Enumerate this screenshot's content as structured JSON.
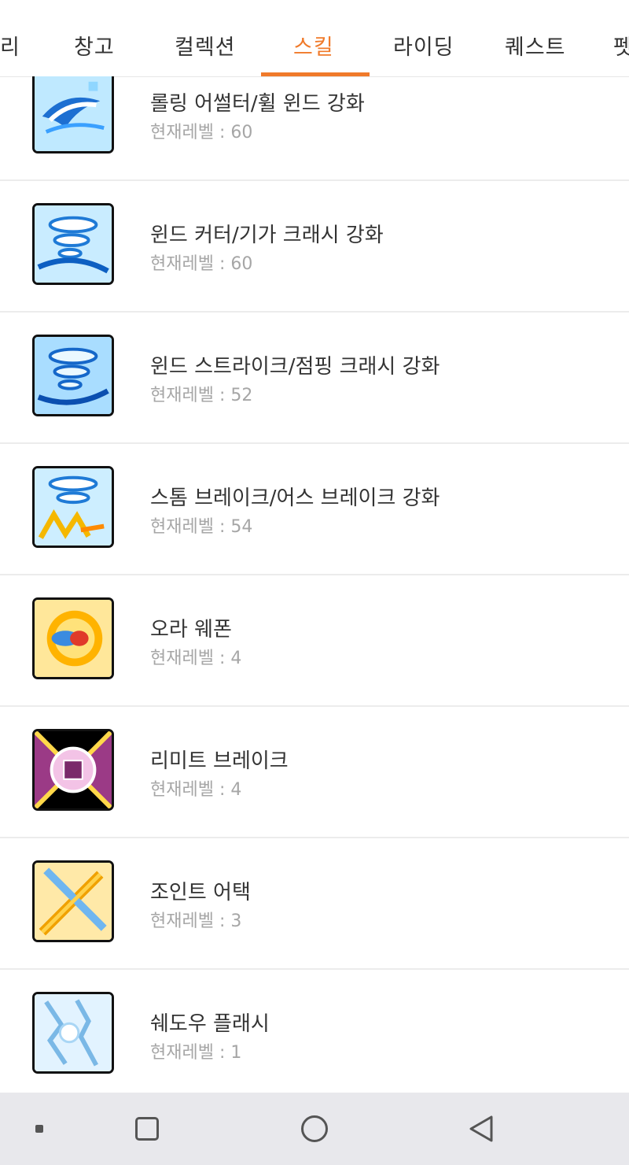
{
  "tabs": [
    {
      "label": "리",
      "active": false
    },
    {
      "label": "창고",
      "active": false
    },
    {
      "label": "컬렉션",
      "active": false
    },
    {
      "label": "스킬",
      "active": true
    },
    {
      "label": "라이딩",
      "active": false
    },
    {
      "label": "퀘스트",
      "active": false
    },
    {
      "label": "펫",
      "active": false
    }
  ],
  "colors": {
    "accent": "#f07a2a",
    "text": "#333333",
    "subtext": "#a6a6a6",
    "divider": "#ececec",
    "navbar": "#e8e8ec"
  },
  "skills": [
    {
      "name": "롤링 어썰터/휠 윈드 강화",
      "level": "현재레벨 : 60",
      "icon": "wind-blue-skill-icon"
    },
    {
      "name": "윈드 커터/기가 크래시 강화",
      "level": "현재레벨 : 60",
      "icon": "tornado-blue-skill-icon"
    },
    {
      "name": "윈드 스트라이크/점핑 크래시 강화",
      "level": "현재레벨 : 52",
      "icon": "tornado-blue-skill-icon"
    },
    {
      "name": "스톰 브레이크/어스 브레이크 강화",
      "level": "현재레벨 : 54",
      "icon": "tornado-yellow-skill-icon"
    },
    {
      "name": "오라 웨폰",
      "level": "현재레벨 : 4",
      "icon": "aura-orb-skill-icon"
    },
    {
      "name": "리미트 브레이크",
      "level": "현재레벨 : 4",
      "icon": "limit-break-skill-icon"
    },
    {
      "name": "조인트 어택",
      "level": "현재레벨 : 3",
      "icon": "crossed-swords-skill-icon"
    },
    {
      "name": "쉐도우 플래시",
      "level": "현재레벨 : 1",
      "icon": "shadow-flash-skill-icon"
    }
  ],
  "navbar": {
    "icons": [
      "recent-dot-icon",
      "overview-square-icon",
      "home-circle-icon",
      "back-triangle-icon"
    ]
  }
}
